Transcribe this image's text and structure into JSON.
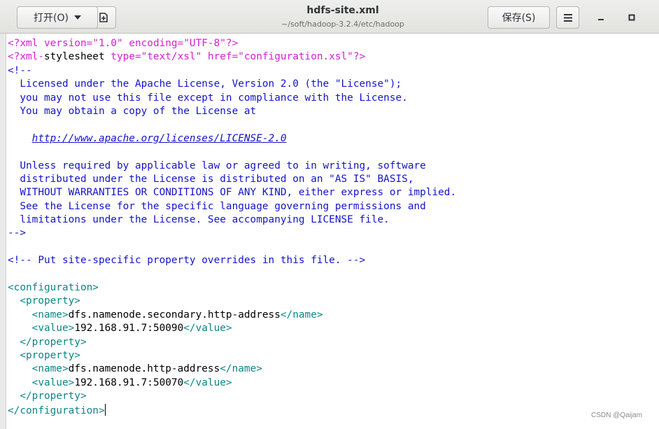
{
  "header": {
    "open_label": "打开(O)",
    "title": "hdfs-site.xml",
    "path": "~/soft/hadoop-3.2.4/etc/hadoop",
    "save_label": "保存(S)"
  },
  "editor": {
    "pi1": {
      "a": "<?xml version=",
      "b": "\"1.0\"",
      "c": " encoding=",
      "d": "\"UTF-8\"",
      "e": "?>"
    },
    "pi2": {
      "a": "<?xml-",
      "kw": "stylesheet",
      "b": " type=",
      "c": "\"text/xsl\"",
      "d": " href=",
      "e": "\"configuration.xsl\"",
      "f": "?>"
    },
    "comment_open": "<!--",
    "license_1": "  Licensed under the Apache License, Version 2.0 (the \"License\");",
    "license_2": "  you may not use this file except in compliance with the License.",
    "license_3": "  You may obtain a copy of the License at",
    "license_url": "http://www.apache.org/licenses/LICENSE-2.0",
    "license_4": "  Unless required by applicable law or agreed to in writing, software",
    "license_5": "  distributed under the License is distributed on an \"AS IS\" BASIS,",
    "license_6": "  WITHOUT WARRANTIES OR CONDITIONS OF ANY KIND, either express or implied.",
    "license_7": "  See the License for the specific language governing permissions and",
    "license_8": "  limitations under the License. See accompanying LICENSE file.",
    "comment_close": "-->",
    "site_comment": "<!-- Put site-specific property overrides in this file. -->",
    "configuration_open": "<configuration>",
    "property_open": "<property>",
    "property_close": "</property>",
    "name_open": "<name>",
    "name_close": "</name>",
    "value_open": "<value>",
    "value_close": "</value>",
    "configuration_close": "</configuration>",
    "properties": [
      {
        "name": "dfs.namenode.secondary.http-address",
        "value": "192.168.91.7:50090"
      },
      {
        "name": "dfs.namenode.http-address",
        "value": "192.168.91.7:50070"
      }
    ]
  },
  "watermark": "CSDN @Qaijam"
}
